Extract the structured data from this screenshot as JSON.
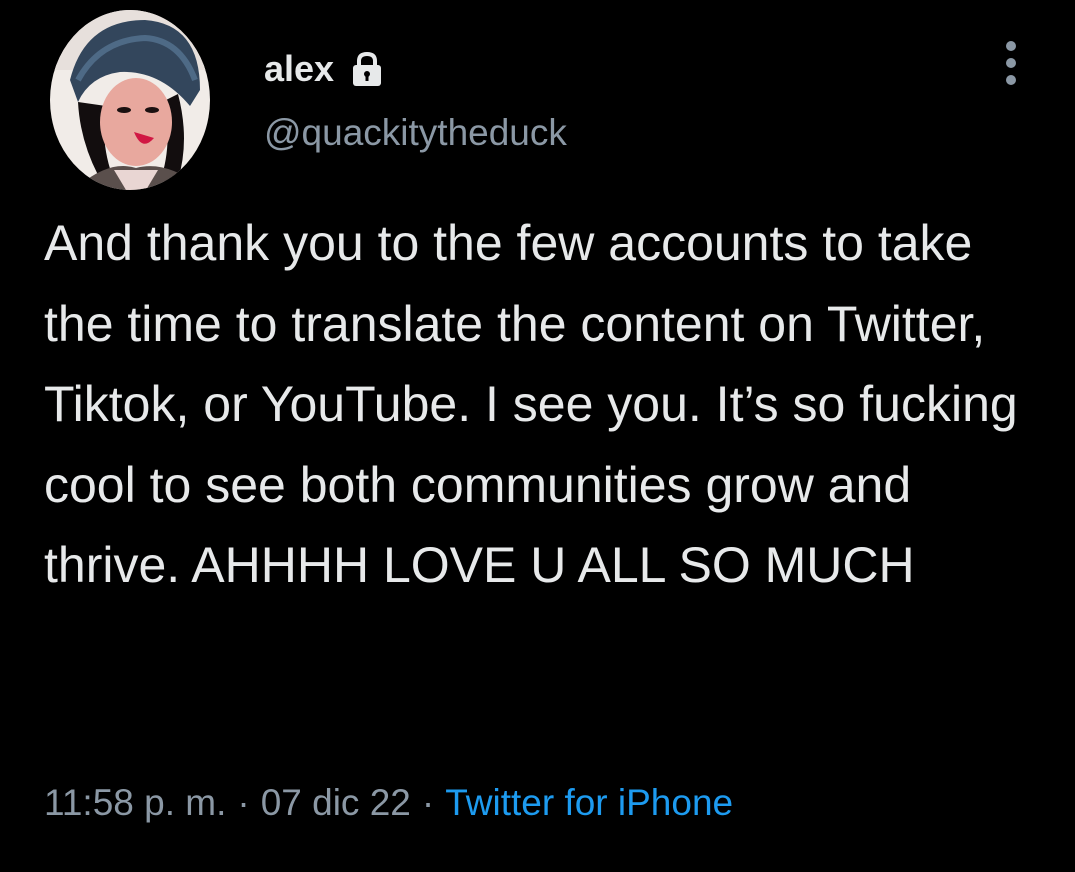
{
  "author": {
    "display_name": "alex",
    "handle": "@quackitytheduck",
    "protected_icon": "lock-icon",
    "avatar_icon": "avatar"
  },
  "tweet": {
    "text": "And thank you to the few accounts to take the time to translate the content on Twitter, Tiktok, or YouTube. I see you. It’s so fucking cool to see both communities grow and thrive. AHHHH LOVE U ALL SO MUCH",
    "time": "11:58 p. m.",
    "date": "07 dic 22",
    "separator": "·",
    "source": "Twitter for iPhone"
  },
  "menu": {
    "icon": "more-vertical-icon"
  },
  "colors": {
    "background": "#000000",
    "text": "#e7e9ea",
    "secondary": "#8b98a5",
    "link": "#1d9bf0"
  }
}
